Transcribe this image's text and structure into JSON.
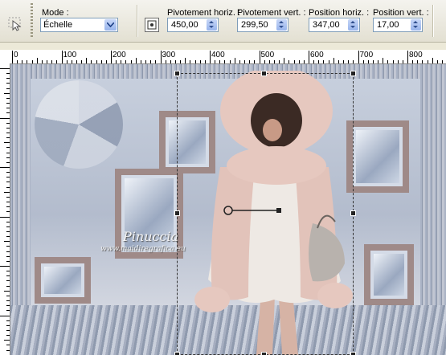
{
  "toolbar": {
    "mode_label": "Mode :",
    "mode_value": "Échelle",
    "rot_h_label": "Pivotement horiz. :",
    "rot_h_value": "450,00",
    "rot_v_label": "Pivotement vert. :",
    "rot_v_value": "299,50",
    "pos_h_label": "Position horiz. :",
    "pos_h_value": "347,00",
    "pos_v_label": "Position vert. :",
    "pos_v_value": "17,00"
  },
  "ruler": {
    "labels": [
      "0",
      "100",
      "200",
      "300",
      "400",
      "500",
      "600",
      "700",
      "800"
    ]
  },
  "canvas": {
    "watermark": "Pinuccia",
    "watermark_url": "www.maidiregrafica.eu"
  },
  "colors": {
    "toolbar_bg": "#ece9d8",
    "input_border": "#7f9db9",
    "frame": "#9f8a88",
    "coat_fur": "#e3c4bb"
  },
  "icons": [
    "pick-tool-icon",
    "center-rotation-icon",
    "dropdown-arrow-icon",
    "spin-up-icon",
    "spin-down-icon"
  ]
}
